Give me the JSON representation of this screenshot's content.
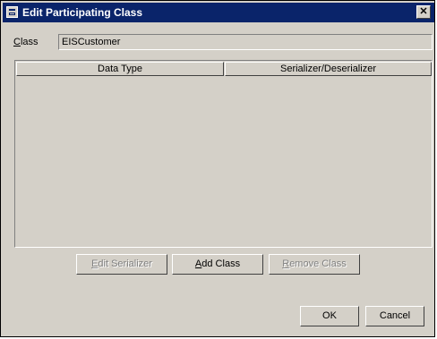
{
  "window": {
    "title": "Edit Participating Class",
    "close_glyph": "✕"
  },
  "form": {
    "class_label": "Class",
    "class_value": "EISCustomer"
  },
  "table": {
    "columns": [
      "Data Type",
      "Serializer/Deserializer"
    ],
    "rows": []
  },
  "buttons": {
    "edit_serializer": "Edit Serializer",
    "add_class": "Add Class",
    "remove_class": "Remove Class",
    "ok": "OK",
    "cancel": "Cancel"
  },
  "icons": {
    "title": "dialog-icon",
    "close": "close-icon"
  },
  "colors": {
    "titlebar": "#0a246a",
    "dialog_bg": "#d4d0c8"
  }
}
